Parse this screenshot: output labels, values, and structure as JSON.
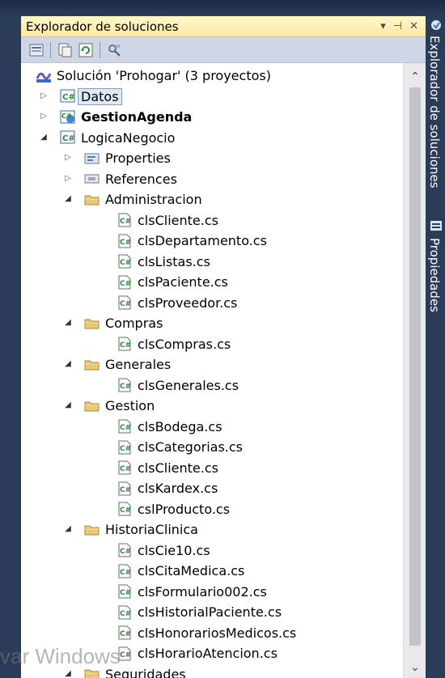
{
  "panel": {
    "title": "Explorador de soluciones",
    "controls": [
      "▾",
      "⊣",
      "✕"
    ]
  },
  "side_tabs": [
    "Explorador de soluciones",
    "Propiedades"
  ],
  "tree": [
    {
      "label": "Solución 'Prohogar'  (3 proyectos)",
      "level": 0,
      "icon": "solution-icon",
      "expander": "none"
    },
    {
      "label": "Datos",
      "level": 1,
      "icon": "csharp-project-icon",
      "expander": "collapsed",
      "selected": true
    },
    {
      "label": "GestionAgenda",
      "level": 1,
      "icon": "web-project-icon",
      "expander": "collapsed",
      "bold": true
    },
    {
      "label": "LogicaNegocio",
      "level": 1,
      "icon": "csharp-project-icon",
      "expander": "expanded"
    },
    {
      "label": "Properties",
      "level": 2,
      "icon": "properties-icon",
      "expander": "collapsed"
    },
    {
      "label": "References",
      "level": 2,
      "icon": "references-icon",
      "expander": "collapsed"
    },
    {
      "label": "Administracion",
      "level": 2,
      "icon": "folder-icon",
      "expander": "expanded"
    },
    {
      "label": "clsCliente.cs",
      "level": 3,
      "icon": "csharp-file-icon",
      "expander": "none"
    },
    {
      "label": "clsDepartamento.cs",
      "level": 3,
      "icon": "csharp-file-icon",
      "expander": "none"
    },
    {
      "label": "clsListas.cs",
      "level": 3,
      "icon": "csharp-file-icon",
      "expander": "none"
    },
    {
      "label": "clsPaciente.cs",
      "level": 3,
      "icon": "csharp-file-icon",
      "expander": "none"
    },
    {
      "label": "clsProveedor.cs",
      "level": 3,
      "icon": "csharp-file-icon",
      "expander": "none"
    },
    {
      "label": "Compras",
      "level": 2,
      "icon": "folder-icon",
      "expander": "expanded"
    },
    {
      "label": "clsCompras.cs",
      "level": 3,
      "icon": "csharp-file-icon",
      "expander": "none"
    },
    {
      "label": "Generales",
      "level": 2,
      "icon": "folder-icon",
      "expander": "expanded"
    },
    {
      "label": "clsGenerales.cs",
      "level": 3,
      "icon": "csharp-file-icon",
      "expander": "none"
    },
    {
      "label": "Gestion",
      "level": 2,
      "icon": "folder-icon",
      "expander": "expanded"
    },
    {
      "label": "clsBodega.cs",
      "level": 3,
      "icon": "csharp-file-icon",
      "expander": "none"
    },
    {
      "label": "clsCategorias.cs",
      "level": 3,
      "icon": "csharp-file-icon",
      "expander": "none"
    },
    {
      "label": "clsCliente.cs",
      "level": 3,
      "icon": "csharp-file-icon",
      "expander": "none"
    },
    {
      "label": "clsKardex.cs",
      "level": 3,
      "icon": "csharp-file-icon",
      "expander": "none"
    },
    {
      "label": "cslProducto.cs",
      "level": 3,
      "icon": "csharp-file-icon",
      "expander": "none"
    },
    {
      "label": "HistoriaClinica",
      "level": 2,
      "icon": "folder-icon",
      "expander": "expanded"
    },
    {
      "label": "clsCie10.cs",
      "level": 3,
      "icon": "csharp-file-icon",
      "expander": "none"
    },
    {
      "label": "clsCitaMedica.cs",
      "level": 3,
      "icon": "csharp-file-icon",
      "expander": "none"
    },
    {
      "label": "clsFormulario002.cs",
      "level": 3,
      "icon": "csharp-file-icon",
      "expander": "none"
    },
    {
      "label": "clsHistorialPaciente.cs",
      "level": 3,
      "icon": "csharp-file-icon",
      "expander": "none"
    },
    {
      "label": "clsHonorariosMedicos.cs",
      "level": 3,
      "icon": "csharp-file-icon",
      "expander": "none"
    },
    {
      "label": "clsHorarioAtencion.cs",
      "level": 3,
      "icon": "csharp-file-icon",
      "expander": "none"
    },
    {
      "label": "Seguridades",
      "level": 2,
      "icon": "folder-icon",
      "expander": "expanded"
    }
  ],
  "watermark": "var Windows",
  "colors": {
    "frame": "#2b3c59",
    "titlebar": "#ffe8a6",
    "toolbar": "#cfd6e5",
    "selection": "#dce9f8",
    "folder": "#e8c874",
    "csharp": "#2e8b3a"
  }
}
